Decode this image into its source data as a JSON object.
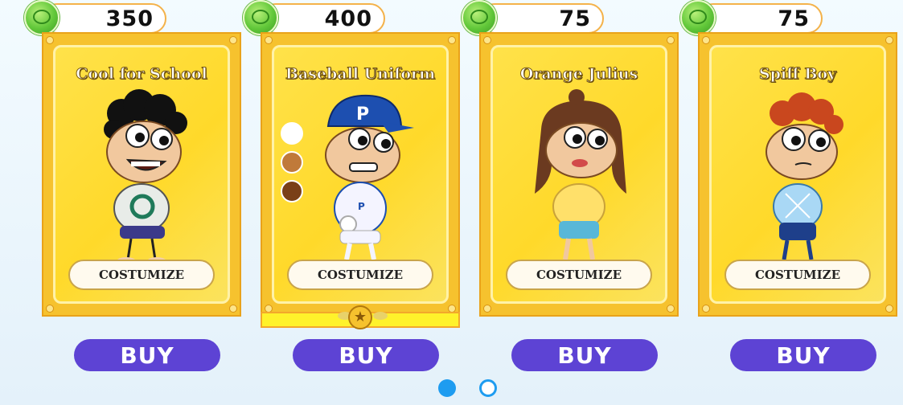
{
  "cards": [
    {
      "price": "350",
      "title": "Cool for School",
      "customize_label": "COSTUMIZE",
      "buy_label": "BUY",
      "colors": {
        "hair": "#111111",
        "shirt": "#e8ece8",
        "accent": "#1f7a5a",
        "pants": "#3b3a8a"
      }
    },
    {
      "price": "400",
      "title": "Baseball Uniform",
      "customize_label": "COSTUMIZE",
      "buy_label": "BUY",
      "colors": {
        "hair": "#222222",
        "shirt": "#f4f4ff",
        "accent": "#1d4fb0",
        "pants": "#f4f4ff"
      }
    },
    {
      "price": "75",
      "title": "Orange Julius",
      "customize_label": "COSTUMIZE",
      "buy_label": "BUY",
      "colors": {
        "hair": "#6b3a20",
        "shirt": "#ffe06a",
        "accent": "#ffe06a",
        "pants": "#58b7d8"
      }
    },
    {
      "price": "75",
      "title": "Spiff Boy",
      "customize_label": "COSTUMIZE",
      "buy_label": "BUY",
      "colors": {
        "hair": "#c9471e",
        "shirt": "#a9d8f5",
        "accent": "#a9d8f5",
        "pants": "#1e3f8a"
      }
    }
  ],
  "swatches": [
    "#ffffff",
    "#c07a3a",
    "#7a4018"
  ],
  "pager": {
    "pages": 2,
    "current": 1
  },
  "theme": {
    "buy": "#5d43d4",
    "card": "#f6c22e",
    "coin": "#62c83a",
    "active_dot": "#1e9cf0"
  }
}
